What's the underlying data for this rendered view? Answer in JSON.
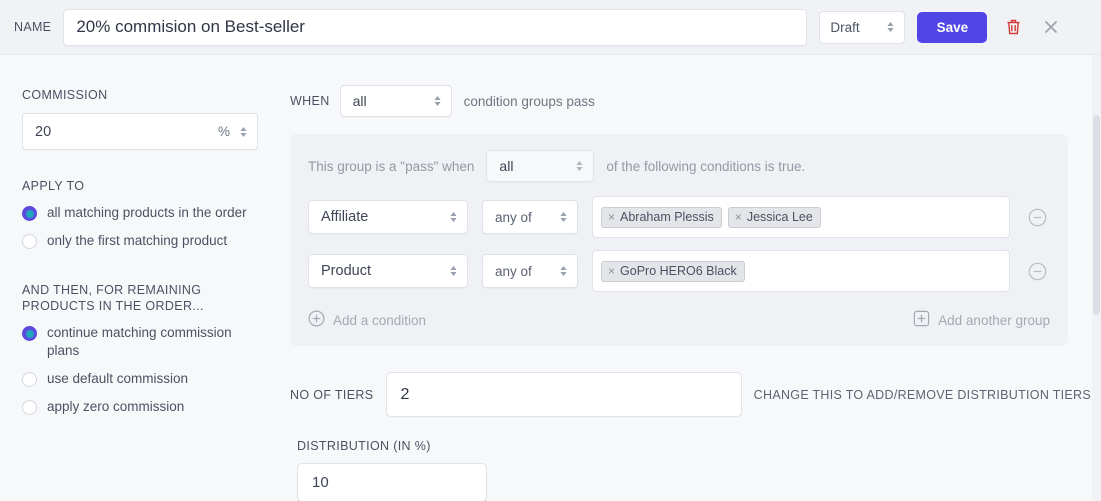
{
  "header": {
    "name_label": "NAME",
    "name_value": "20% commision on Best-seller",
    "name_placeholder": "Name",
    "status_value": "Draft",
    "save_label": "Save",
    "delete_icon": "trash-icon",
    "close_icon": "close-icon"
  },
  "sidebar": {
    "commission_label": "COMMISSION",
    "commission_value": "20",
    "commission_suffix": "%",
    "apply_to_label": "APPLY TO",
    "apply_to_options": [
      {
        "label": "all matching products in the order",
        "checked": true
      },
      {
        "label": "only the first matching product",
        "checked": false
      }
    ],
    "remaining_label": "AND THEN, FOR REMAINING PRODUCTS IN THE ORDER...",
    "remaining_options": [
      {
        "label": "continue matching commission plans",
        "checked": true
      },
      {
        "label": "use default commission",
        "checked": false
      },
      {
        "label": "apply zero commission",
        "checked": false
      }
    ]
  },
  "main": {
    "when_label": "WHEN",
    "when_value": "all",
    "when_suffix": "condition groups pass",
    "group": {
      "prefix_text": "This group is a \"pass\" when",
      "match_value": "all",
      "suffix_text": "of the following conditions is true.",
      "conditions": [
        {
          "field": "Affiliate",
          "operator": "any of",
          "tags": [
            "Abraham Plessis",
            "Jessica Lee"
          ]
        },
        {
          "field": "Product",
          "operator": "any of",
          "tags": [
            "GoPro HERO6 Black"
          ]
        }
      ],
      "add_condition_label": "Add a condition",
      "add_group_label": "Add another group"
    },
    "tiers_label": "NO OF TIERS",
    "tiers_value": "2",
    "tiers_hint": "CHANGE THIS TO ADD/REMOVE DISTRIBUTION TIERS",
    "distribution_label": "DISTRIBUTION (IN %)",
    "distribution_value": "10"
  },
  "colors": {
    "accent": "#5046e5",
    "radio_ring": "#5b4ae0",
    "radio_dot": "#1fa6ba",
    "danger": "#d63838",
    "page_bg": "#f7f8fa",
    "header_bg": "#f1f2f5",
    "group_bg": "#f0f1f4"
  }
}
